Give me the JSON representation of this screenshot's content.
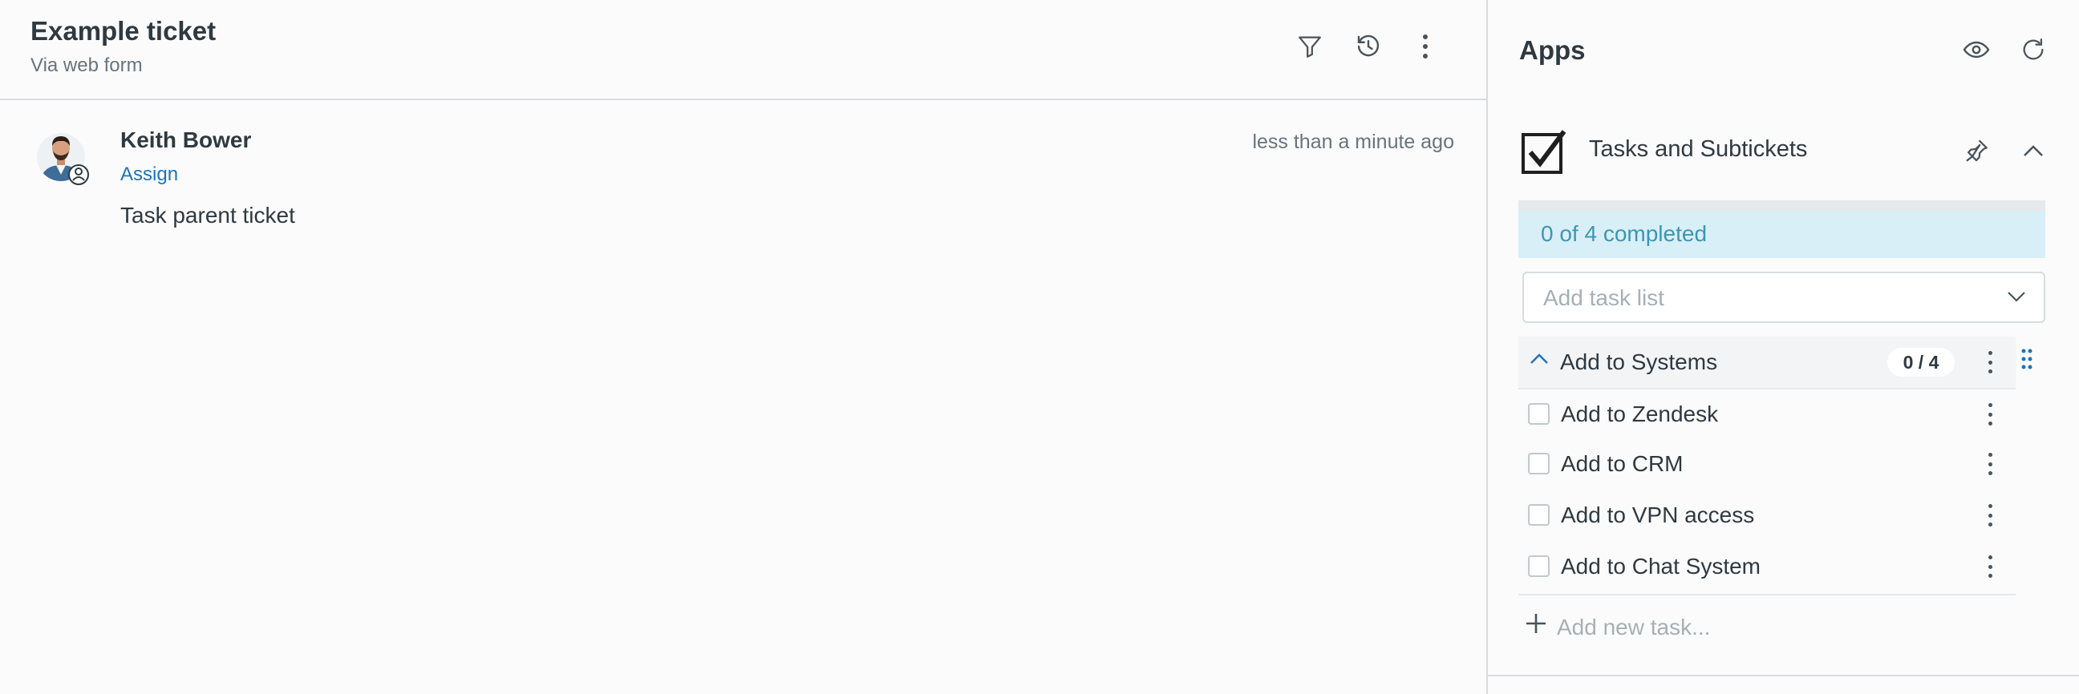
{
  "ticket": {
    "title": "Example ticket",
    "subtitle": "Via web form"
  },
  "header_icons": [
    "filter-icon",
    "history-icon",
    "more-icon"
  ],
  "comment": {
    "author": "Keith Bower",
    "timestamp": "less than a minute ago",
    "assign_label": "Assign",
    "body": "Task parent ticket"
  },
  "apps": {
    "title": "Apps",
    "icons": [
      "eye-icon",
      "refresh-icon"
    ]
  },
  "tasks_app": {
    "name": "Tasks and Subtickets",
    "progress_text": "0 of 4 completed",
    "progress_fraction": 0,
    "select_placeholder": "Add task list",
    "list": {
      "name": "Add to Systems",
      "count": "0 / 4",
      "items": [
        {
          "label": "Add to Zendesk",
          "checked": false
        },
        {
          "label": "Add to CRM",
          "checked": false
        },
        {
          "label": "Add to VPN access",
          "checked": false
        },
        {
          "label": "Add to Chat System",
          "checked": false
        }
      ]
    },
    "add_task_placeholder": "Add new task..."
  },
  "colors": {
    "link": "#1f73b7",
    "progress_bg": "#d9eff7",
    "progress_text": "#3c96b3"
  }
}
